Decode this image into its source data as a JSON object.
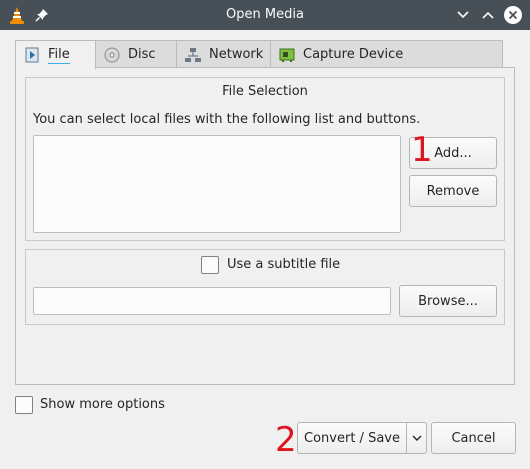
{
  "window": {
    "title": "Open Media",
    "icons": [
      "vlc-cone-icon",
      "pin-icon",
      "minimize-icon",
      "maximize-icon",
      "close-icon"
    ]
  },
  "tabs": [
    {
      "label": "File",
      "icon": "file-icon",
      "active": true
    },
    {
      "label": "Disc",
      "icon": "disc-icon",
      "active": false
    },
    {
      "label": "Network",
      "icon": "network-icon",
      "active": false
    },
    {
      "label": "Capture Device",
      "icon": "capture-card-icon",
      "active": false
    }
  ],
  "file_selection": {
    "title": "File Selection",
    "description": "You can select local files with the following list and buttons.",
    "add_label": "Add...",
    "remove_label": "Remove"
  },
  "subtitle": {
    "checkbox_label": "Use a subtitle file",
    "checked": false,
    "path_value": "",
    "browse_label": "Browse..."
  },
  "options": {
    "show_more_label": "Show more options",
    "show_more_checked": false
  },
  "actions": {
    "convert_label": "Convert / Save",
    "cancel_label": "Cancel"
  },
  "markers": {
    "first": "1",
    "second": "2"
  },
  "colors": {
    "titlebar": "#475057",
    "accent": "#3daee9",
    "marker": "#e0141e",
    "vlc_orange": "#f28c00"
  }
}
